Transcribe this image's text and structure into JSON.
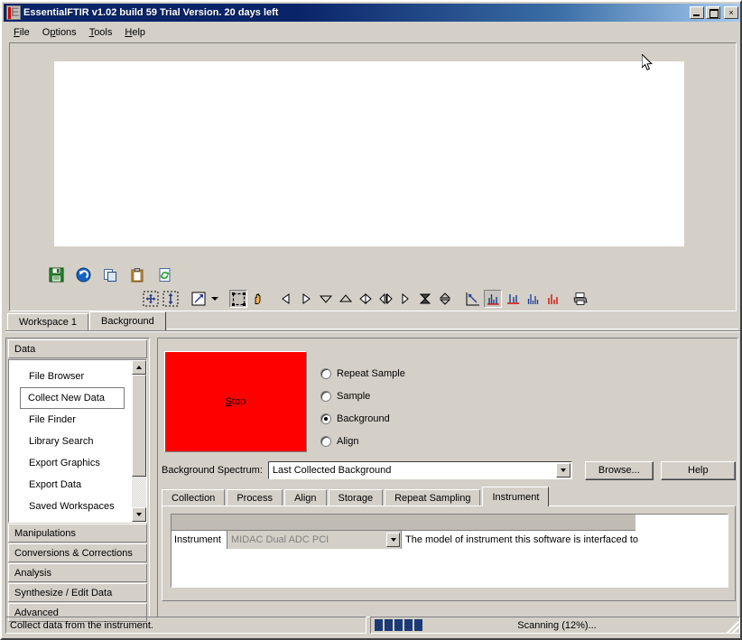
{
  "window": {
    "title": "EssentialFTIR v1.02 build 59 Trial Version. 20 days left",
    "minimize_label": "",
    "maximize_label": "",
    "close_label": "×"
  },
  "menu": {
    "items": [
      {
        "label": "File"
      },
      {
        "label": "Options"
      },
      {
        "label": "Tools"
      },
      {
        "label": "Help"
      }
    ]
  },
  "toolbar_primary": {
    "icons": [
      {
        "name": "save-icon",
        "title": "Save"
      },
      {
        "name": "undo-icon",
        "title": "Undo"
      },
      {
        "name": "copy-icon",
        "title": "Copy"
      },
      {
        "name": "paste-icon",
        "title": "Paste"
      },
      {
        "name": "refresh-icon",
        "title": "Refresh"
      }
    ]
  },
  "toolbar_secondary": {
    "icons": [
      {
        "name": "pan-move-icon",
        "title": "Pan"
      },
      {
        "name": "vertical-scale-icon",
        "title": "Vertical Scale"
      },
      {
        "name": "zoom-region-icon",
        "title": "Zoom Region"
      },
      {
        "name": "zoom-dropdown-caret",
        "title": "Zoom Options"
      },
      {
        "name": "select-box-icon",
        "title": "Select Region"
      },
      {
        "name": "hand-grab-icon",
        "title": "Grab"
      },
      {
        "name": "step-left-icon",
        "title": "Step Left"
      },
      {
        "name": "step-right-icon",
        "title": "Step Right"
      },
      {
        "name": "expand-down-icon",
        "title": "Expand Down"
      },
      {
        "name": "expand-up-icon",
        "title": "Expand Up"
      },
      {
        "name": "jump-end-icon",
        "title": "Jump To End"
      },
      {
        "name": "shift-left-icon",
        "title": "Shift Left"
      },
      {
        "name": "shift-right-icon",
        "title": "Shift Right"
      },
      {
        "name": "hourglass-icon",
        "title": "Busy"
      },
      {
        "name": "updown-arrows-icon",
        "title": "Offset"
      },
      {
        "name": "resize-diagonal-icon",
        "title": "Autoscale"
      },
      {
        "name": "peaks-pick-icon",
        "title": "Peak Pick"
      },
      {
        "name": "peaks-blue-icon",
        "title": "Peak Labels"
      },
      {
        "name": "peaks-dense-icon",
        "title": "Peak Table"
      },
      {
        "name": "peaks-red-icon",
        "title": "Peak Areas"
      },
      {
        "name": "print-icon",
        "title": "Print"
      }
    ]
  },
  "workspace_tabs": [
    {
      "label": "Workspace 1",
      "active": false
    },
    {
      "label": "Background",
      "active": true
    }
  ],
  "sidebar": {
    "sections": [
      {
        "label": "Data",
        "expanded": true
      },
      {
        "label": "Manipulations",
        "expanded": false
      },
      {
        "label": "Conversions & Corrections",
        "expanded": false
      },
      {
        "label": "Analysis",
        "expanded": false
      },
      {
        "label": "Synthesize / Edit Data",
        "expanded": false
      },
      {
        "label": "Advanced",
        "expanded": false
      }
    ],
    "data_items": [
      {
        "label": "File Browser",
        "selected": false
      },
      {
        "label": "Collect New Data",
        "selected": true
      },
      {
        "label": "File Finder",
        "selected": false
      },
      {
        "label": "Library Search",
        "selected": false
      },
      {
        "label": "Export Graphics",
        "selected": false
      },
      {
        "label": "Export Data",
        "selected": false
      },
      {
        "label": "Saved Workspaces",
        "selected": false
      }
    ]
  },
  "collect_panel": {
    "stop_button": {
      "label": "Stop",
      "accel": "S",
      "color": "#ff0000"
    },
    "modes": [
      {
        "label": "Repeat Sample",
        "selected": false
      },
      {
        "label": "Sample",
        "selected": false
      },
      {
        "label": "Background",
        "selected": true
      },
      {
        "label": "Align",
        "selected": false
      }
    ],
    "background_spectrum": {
      "label": "Background Spectrum:",
      "value": "Last Collected Background",
      "browse_label": "Browse...",
      "help_label": "Help"
    },
    "tabs": [
      {
        "label": "Collection",
        "active": false
      },
      {
        "label": "Process",
        "active": false
      },
      {
        "label": "Align",
        "active": false
      },
      {
        "label": "Storage",
        "active": false
      },
      {
        "label": "Repeat Sampling",
        "active": false
      },
      {
        "label": "Instrument",
        "active": true
      }
    ],
    "instrument_grid": {
      "property_name": "Instrument",
      "property_value": "MIDAC Dual ADC PCI",
      "description": "The model of instrument this software is interfaced to"
    }
  },
  "statusbar": {
    "message": "Collect data from the instrument.",
    "progress_text": "Scanning (12%)...",
    "progress_percent": 12,
    "progress_segments": 5,
    "progress_color": "#1b3a75"
  }
}
